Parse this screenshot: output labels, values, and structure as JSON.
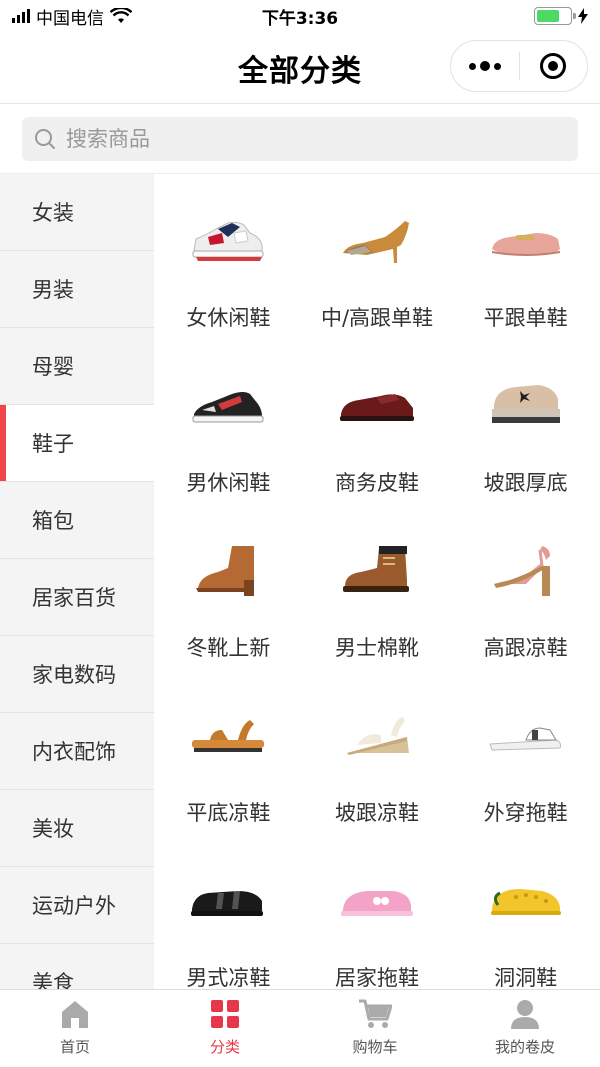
{
  "status_bar": {
    "carrier": "中国电信",
    "time": "下午3:36",
    "battery_percent": 70
  },
  "navbar": {
    "title": "全部分类"
  },
  "search": {
    "placeholder": "搜索商品"
  },
  "sidebar": {
    "items": [
      {
        "label": "女装"
      },
      {
        "label": "男装"
      },
      {
        "label": "母婴"
      },
      {
        "label": "鞋子"
      },
      {
        "label": "箱包"
      },
      {
        "label": "居家百货"
      },
      {
        "label": "家电数码"
      },
      {
        "label": "内衣配饰"
      },
      {
        "label": "美妆"
      },
      {
        "label": "运动户外"
      },
      {
        "label": "美食"
      }
    ],
    "active_index": 3
  },
  "categories": [
    {
      "label": "女休闲鞋",
      "icon": "womens-sneaker-icon"
    },
    {
      "label": "中/高跟单鞋",
      "icon": "high-heel-pump-icon"
    },
    {
      "label": "平跟单鞋",
      "icon": "flat-loafer-icon"
    },
    {
      "label": "男休闲鞋",
      "icon": "mens-sneaker-icon"
    },
    {
      "label": "商务皮鞋",
      "icon": "oxford-shoe-icon"
    },
    {
      "label": "坡跟厚底",
      "icon": "platform-shoe-icon"
    },
    {
      "label": "冬靴上新",
      "icon": "ankle-boot-icon"
    },
    {
      "label": "男士棉靴",
      "icon": "work-boot-icon"
    },
    {
      "label": "高跟凉鞋",
      "icon": "heeled-sandal-icon"
    },
    {
      "label": "平底凉鞋",
      "icon": "flat-sandal-icon"
    },
    {
      "label": "坡跟凉鞋",
      "icon": "wedge-sandal-icon"
    },
    {
      "label": "外穿拖鞋",
      "icon": "mule-slipper-icon"
    },
    {
      "label": "男式凉鞋",
      "icon": "mens-sandal-icon"
    },
    {
      "label": "居家拖鞋",
      "icon": "home-slipper-icon"
    },
    {
      "label": "洞洞鞋",
      "icon": "clog-icon"
    }
  ],
  "tabbar": {
    "items": [
      {
        "label": "首页",
        "icon": "home-icon"
      },
      {
        "label": "分类",
        "icon": "category-grid-icon"
      },
      {
        "label": "购物车",
        "icon": "cart-icon"
      },
      {
        "label": "我的卷皮",
        "icon": "user-icon"
      }
    ],
    "active_index": 1
  },
  "colors": {
    "accent": "#e7374b",
    "sidebar_bg": "#f4f4f4",
    "active_bar": "#f2454a"
  }
}
